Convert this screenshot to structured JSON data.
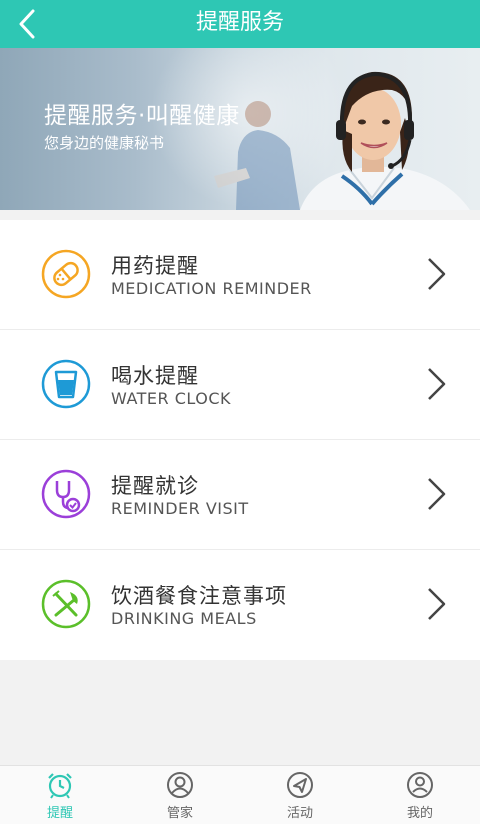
{
  "header": {
    "title": "提醒服务"
  },
  "banner": {
    "headline": "提醒服务·叫醒健康",
    "subtitle": "您身边的健康秘书"
  },
  "items": [
    {
      "zh": "用药提醒",
      "en": "MEDICATION REMINDER",
      "icon": "pill-icon",
      "color": "#f5a623"
    },
    {
      "zh": "喝水提醒",
      "en": "WATER CLOCK",
      "icon": "water-glass-icon",
      "color": "#1e9ad6"
    },
    {
      "zh": "提醒就诊",
      "en": "REMINDER VISIT",
      "icon": "stethoscope-icon",
      "color": "#9b3fd9"
    },
    {
      "zh": "饮酒餐食注意事项",
      "en": "DRINKING MEALS",
      "icon": "fork-knife-icon",
      "color": "#5bbf2a"
    }
  ],
  "tabs": [
    {
      "label": "提醒",
      "icon": "alarm-clock-icon",
      "active": true
    },
    {
      "label": "管家",
      "icon": "user-circle-icon",
      "active": false
    },
    {
      "label": "活动",
      "icon": "send-icon",
      "active": false
    },
    {
      "label": "我的",
      "icon": "person-icon",
      "active": false
    }
  ],
  "colors": {
    "accent": "#2ec7b4",
    "background": "#f2f2f2"
  }
}
